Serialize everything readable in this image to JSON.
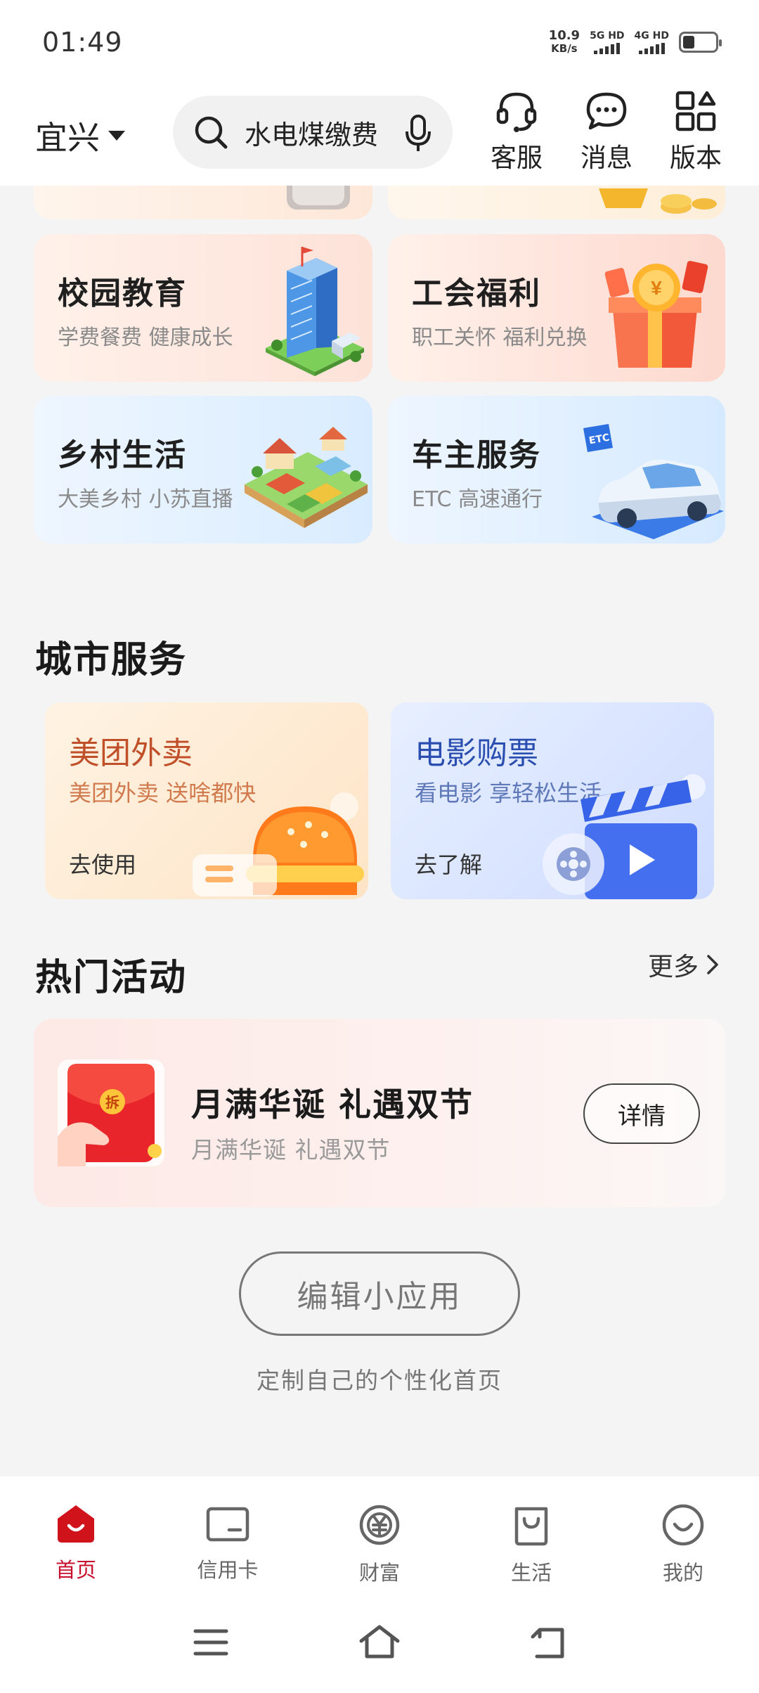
{
  "status": {
    "time": "01:49",
    "net_speed_value": "10.9",
    "net_speed_unit": "KB/s",
    "sim1": "5G HD",
    "sim2": "4G HD"
  },
  "header": {
    "city": "宜兴",
    "search_text": "水电煤缴费",
    "service_label": "客服",
    "message_label": "消息",
    "version_label": "版本"
  },
  "feature_cards": [
    {
      "title": "校园教育",
      "subtitle": "学费餐费 健康成长"
    },
    {
      "title": "工会福利",
      "subtitle": "职工关怀 福利兑换"
    },
    {
      "title": "乡村生活",
      "subtitle": "大美乡村 小苏直播"
    },
    {
      "title": "车主服务",
      "subtitle": "ETC 高速通行",
      "badge": "ETC"
    }
  ],
  "city_services": {
    "title": "城市服务",
    "items": [
      {
        "title": "美团外卖",
        "subtitle": "美团外卖 送啥都快",
        "action": "去使用",
        "color": "#c0502a"
      },
      {
        "title": "电影购票",
        "subtitle": "看电影 享轻松生活",
        "action": "去了解",
        "color": "#2b4fb0"
      }
    ]
  },
  "hot_activities": {
    "title": "热门活动",
    "more": "更多",
    "promo": {
      "title": "月满华诞 礼遇双节",
      "subtitle": "月满华诞 礼遇双节",
      "button": "详情",
      "envelope_char": "拆"
    }
  },
  "customize": {
    "edit_button": "编辑小应用",
    "hint": "定制自己的个性化首页"
  },
  "tabs": [
    {
      "label": "首页",
      "icon": "home-icon",
      "active": true
    },
    {
      "label": "信用卡",
      "icon": "credit-card-icon",
      "active": false
    },
    {
      "label": "财富",
      "icon": "wealth-icon",
      "active": false
    },
    {
      "label": "生活",
      "icon": "shopping-bag-icon",
      "active": false
    },
    {
      "label": "我的",
      "icon": "smiley-icon",
      "active": false
    }
  ],
  "colors": {
    "accent": "#c8102e",
    "background": "#f4f4f5"
  }
}
